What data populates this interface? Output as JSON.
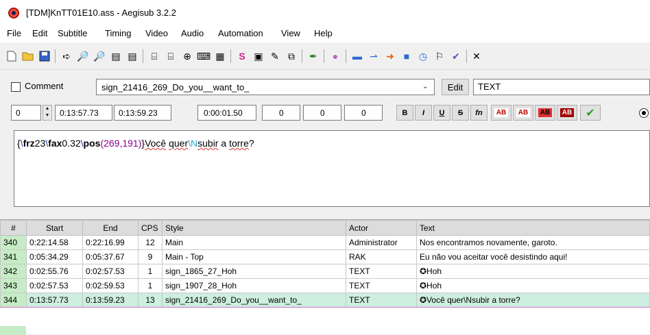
{
  "window": {
    "title": "[TDM]KnTT01E10.ass - Aegisub 3.2.2"
  },
  "menu": [
    "File",
    "Edit",
    "Subtitle",
    "Timing",
    "Video",
    "Audio",
    "Automation",
    "View",
    "Help"
  ],
  "toolbar": {
    "icons": [
      "new-file-icon",
      "open-folder-icon",
      "save-icon",
      "jump-to-icon",
      "find-icon",
      "replace-icon",
      "copy-style-icon",
      "paste-style-icon",
      "shift-times-icon",
      "styles-manager-icon",
      "attachments-icon",
      "fonts-collector-icon",
      "export-icon",
      "spellcheck-icon",
      "properties-icon",
      "resample-icon",
      "select-lines-icon",
      "automation-icon",
      "kanji-timer-icon",
      "snap-start-icon",
      "snap-end-icon",
      "play-line-icon",
      "stop-icon",
      "timing-postprocessor-icon",
      "translation-assistant-icon",
      "style-helper-icon",
      "close-icon"
    ]
  },
  "editor": {
    "comment_label": "Comment",
    "style": "sign_21416_269_Do_you__want_to_",
    "edit_button": "Edit",
    "actor": "TEXT",
    "layer": "0",
    "start_time": "0:13:57.73",
    "end_time": "0:13:59.23",
    "duration": "0:00:01.50",
    "margin_left": "0",
    "margin_right": "0",
    "margin_vertical": "0",
    "format_buttons": [
      "B",
      "I",
      "U",
      "S",
      "fn"
    ],
    "color_buttons": [
      "AB",
      "AB",
      "AB",
      "AB"
    ],
    "commit_icon": "✔",
    "text": {
      "brace_open": "{",
      "tag1_bs": "\\",
      "tag1_name": "frz",
      "tag1_val": "23",
      "tag2_bs": "\\",
      "tag2_name": "fax",
      "tag2_val": "0.32",
      "tag3_bs": "\\",
      "tag3_name": "pos",
      "tag3_val": "(269,191)",
      "brace_close": "}",
      "word1": "Você",
      "word2": "quer",
      "line_break": "\\N",
      "word3": "subir",
      "word4": "a",
      "word5": "torre",
      "end": "?"
    }
  },
  "grid": {
    "headers": [
      "#",
      "Start",
      "End",
      "CPS",
      "Style",
      "Actor",
      "Text"
    ],
    "rows": [
      {
        "num": "340",
        "start": "0:22:14.58",
        "end": "0:22:16.99",
        "cps": "12",
        "style": "Main",
        "actor": "Administrator",
        "text": "Nos encontramos novamente, garoto."
      },
      {
        "num": "341",
        "start": "0:05:34.29",
        "end": "0:05:37.67",
        "cps": "9",
        "style": "Main - Top",
        "actor": "RAK",
        "text": "Eu não vou aceitar você desistindo aqui!"
      },
      {
        "num": "342",
        "start": "0:02:55.76",
        "end": "0:02:57.53",
        "cps": "1",
        "style": "sign_1865_27_Hoh",
        "actor": "TEXT",
        "text": "✪Hoh"
      },
      {
        "num": "343",
        "start": "0:02:57.53",
        "end": "0:02:59.53",
        "cps": "1",
        "style": "sign_1907_28_Hoh",
        "actor": "TEXT",
        "text": "✪Hoh"
      },
      {
        "num": "344",
        "start": "0:13:57.73",
        "end": "0:13:59.23",
        "cps": "13",
        "style": "sign_21416_269_Do_you__want_to_",
        "actor": "TEXT",
        "text": "✪Você quer\\Nsubir a torre?"
      }
    ],
    "selected_row": "344"
  },
  "colors": {
    "line_number_bg": "#c6ecc6",
    "selected_row_bg": "#cdeee0",
    "tag_color": "#1e3fb5",
    "escape_color": "#2aa8c8"
  }
}
